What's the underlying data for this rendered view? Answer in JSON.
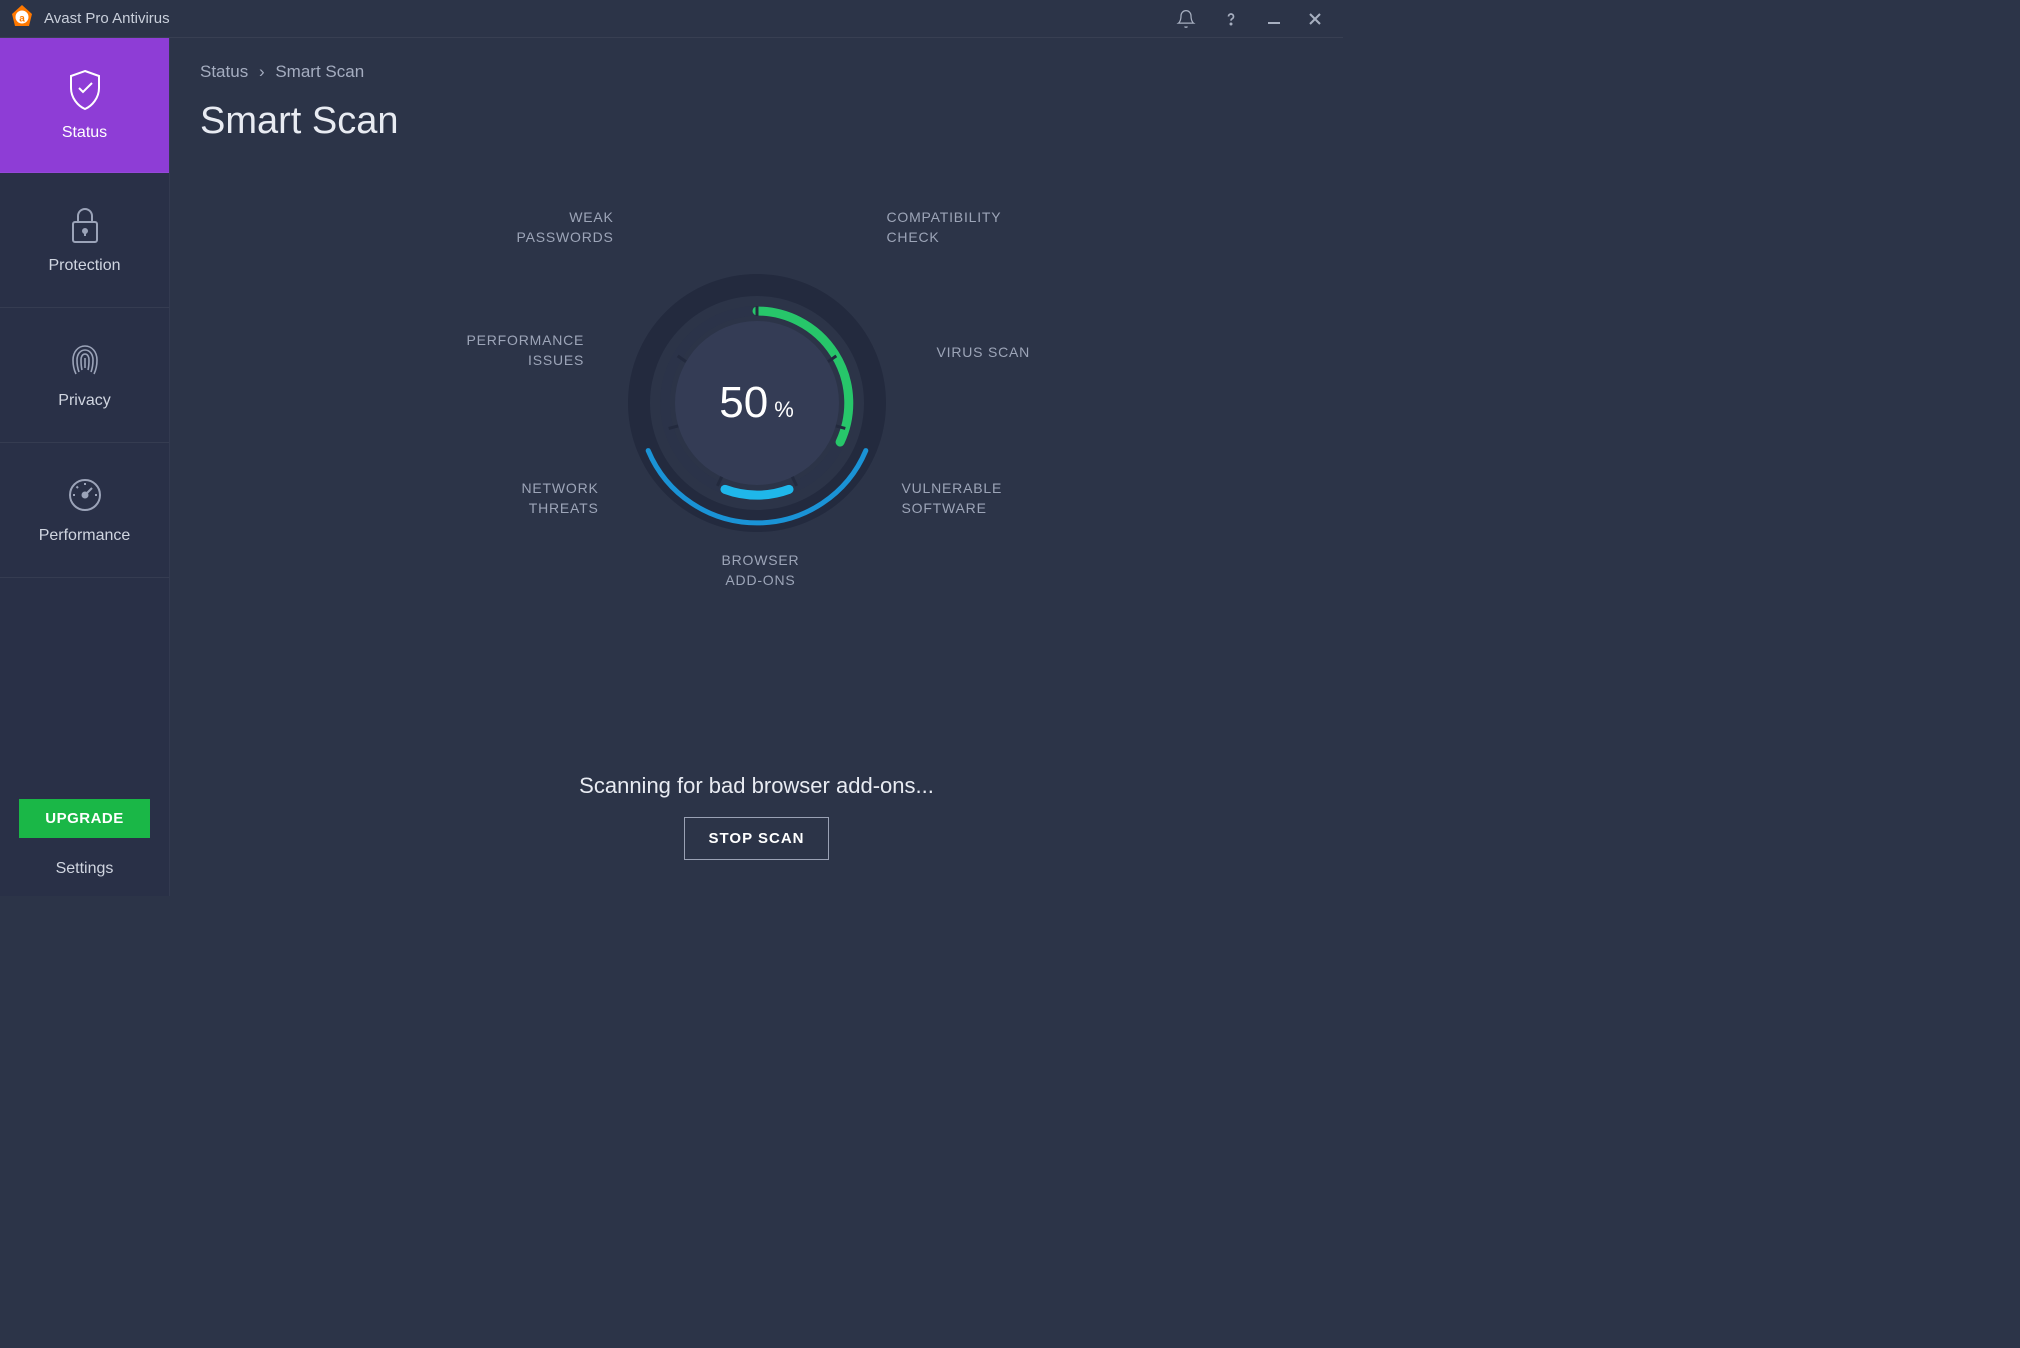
{
  "app": {
    "title": "Avast Pro Antivirus"
  },
  "sidebar": {
    "items": [
      {
        "label": "Status",
        "active": true
      },
      {
        "label": "Protection",
        "active": false
      },
      {
        "label": "Privacy",
        "active": false
      },
      {
        "label": "Performance",
        "active": false
      }
    ],
    "upgrade_label": "UPGRADE",
    "settings_label": "Settings"
  },
  "breadcrumb": {
    "items": [
      "Status",
      "Smart Scan"
    ]
  },
  "page": {
    "title": "Smart Scan"
  },
  "scan": {
    "percent": "50",
    "percent_sign": "%",
    "labels": {
      "weak_passwords": "WEAK\nPASSWORDS",
      "compatibility_check": "COMPATIBILITY\nCHECK",
      "performance_issues": "PERFORMANCE\nISSUES",
      "virus_scan": "VIRUS SCAN",
      "network_threats": "NETWORK\nTHREATS",
      "vulnerable_software": "VULNERABLE\nSOFTWARE",
      "browser_addons": "BROWSER\nADD-ONS"
    },
    "status_text": "Scanning for bad browser add-ons...",
    "stop_label": "STOP SCAN"
  }
}
